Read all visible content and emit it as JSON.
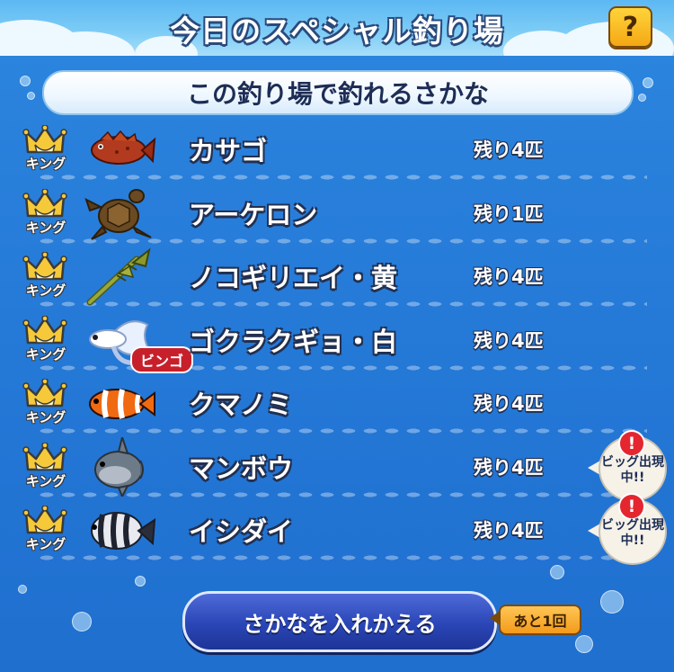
{
  "header": {
    "title": "今日のスペシャル釣り場",
    "help_label": "?"
  },
  "subtitle": "この釣り場で釣れるさかな",
  "king_label": "キング",
  "fish_list": [
    {
      "name": "カサゴ",
      "remaining": "残り4匹",
      "icon": "scorpionfish-icon",
      "bingo": false,
      "big": false
    },
    {
      "name": "アーケロン",
      "remaining": "残り1匹",
      "icon": "sea-turtle-icon",
      "bingo": false,
      "big": false
    },
    {
      "name": "ノコギリエイ・黄",
      "remaining": "残り4匹",
      "icon": "sawfish-icon",
      "bingo": false,
      "big": false
    },
    {
      "name": "ゴクラクギョ・白",
      "remaining": "残り4匹",
      "icon": "betta-fish-icon",
      "bingo": true,
      "bingo_label": "ビンゴ",
      "big": false
    },
    {
      "name": "クマノミ",
      "remaining": "残り4匹",
      "icon": "clownfish-icon",
      "bingo": false,
      "big": false
    },
    {
      "name": "マンボウ",
      "remaining": "残り4匹",
      "icon": "sunfish-icon",
      "bingo": false,
      "big": true,
      "big_label": "ビッグ出現中!!"
    },
    {
      "name": "イシダイ",
      "remaining": "残り4匹",
      "icon": "striped-beakfish-icon",
      "bingo": false,
      "big": true,
      "big_label": "ビッグ出現中!!"
    }
  ],
  "footer": {
    "swap_button": "さかなを入れかえる",
    "remaining_badge": "あと1回"
  }
}
